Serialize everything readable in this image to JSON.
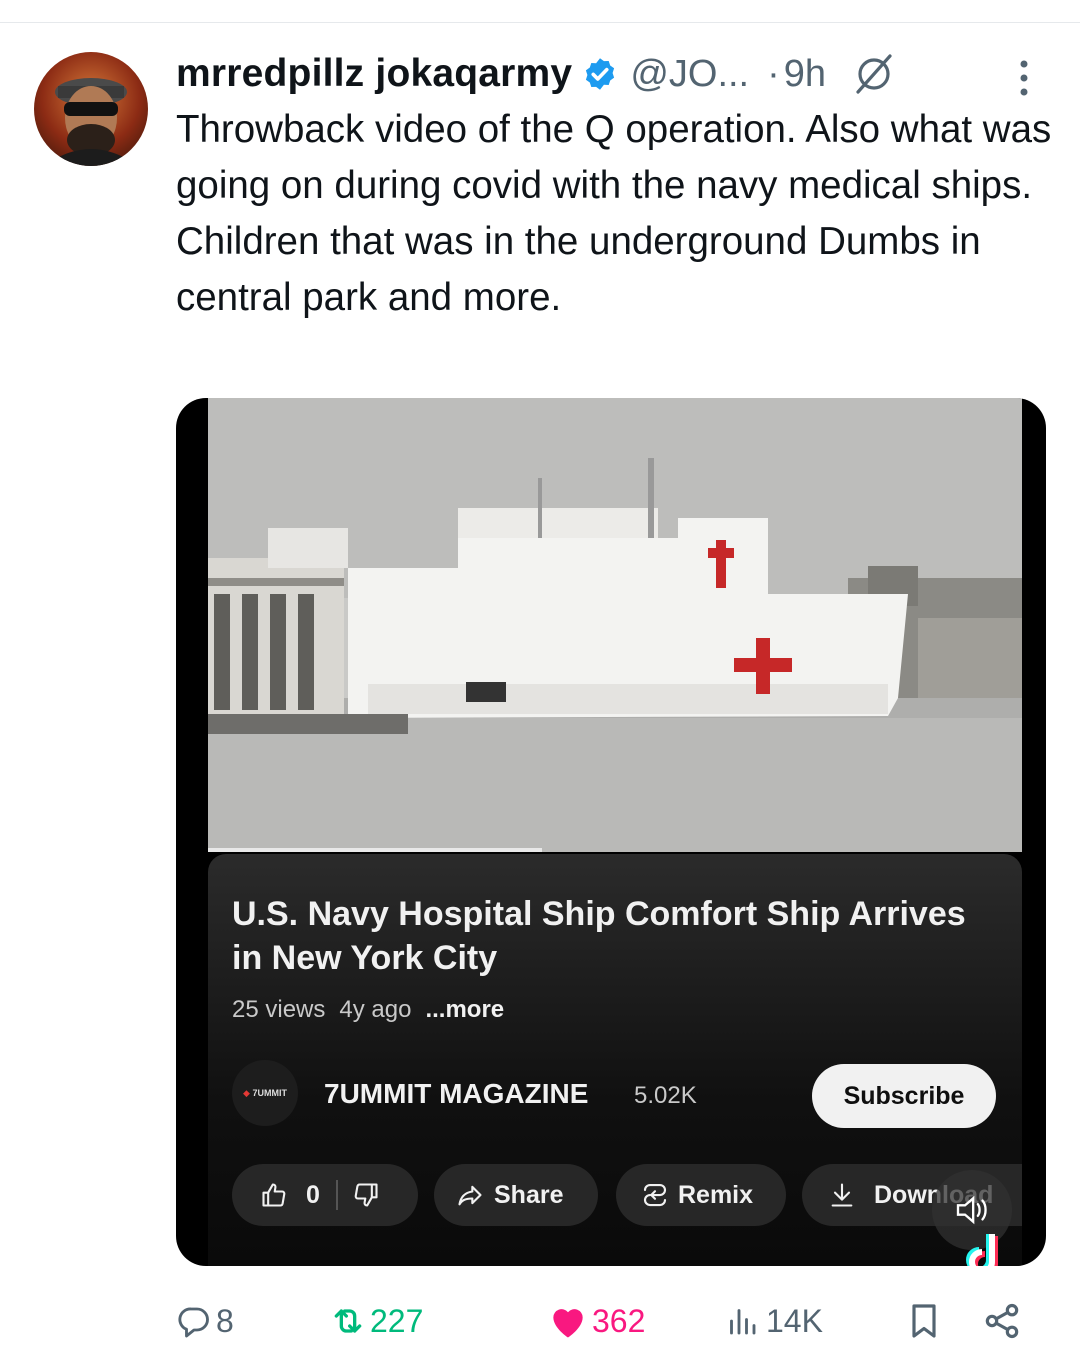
{
  "post": {
    "display_name": "mrredpillz jokaqarmy",
    "handle": "@JO...",
    "dot": "·",
    "time": "9h",
    "text": "Throwback video of the Q operation. Also what was going on during covid with the navy medical ships. Children that was in the underground Dumbs in central park and more."
  },
  "video": {
    "title": "U.S. Navy Hospital Ship Comfort Ship Arrives in New York City",
    "views": "25 views",
    "age": "4y ago",
    "more_label": "...more",
    "channel_name": "7UMMIT MAGAZINE",
    "channel_subs": "5.02K",
    "channel_logo_text": "7UMMIT",
    "subscribe_label": "Subscribe",
    "like_count": "0",
    "share_label": "Share",
    "remix_label": "Remix",
    "download_label": "Download",
    "watch_progress": 0.41
  },
  "actions": {
    "replies": "8",
    "reposts": "227",
    "likes": "362",
    "views": "14K"
  },
  "colors": {
    "verified": "#1d9bf0",
    "like": "#f91880",
    "repost": "#00ba7c",
    "muted": "#536471"
  },
  "icons": [
    "verified-badge-icon",
    "grok-icon",
    "more-options-icon",
    "like-icon",
    "dislike-icon",
    "share-arrow-icon",
    "remix-icon",
    "download-icon",
    "sound-icon",
    "tiktok-logo-icon",
    "reply-icon",
    "repost-icon",
    "heart-icon",
    "views-icon",
    "bookmark-icon",
    "share-icon"
  ]
}
